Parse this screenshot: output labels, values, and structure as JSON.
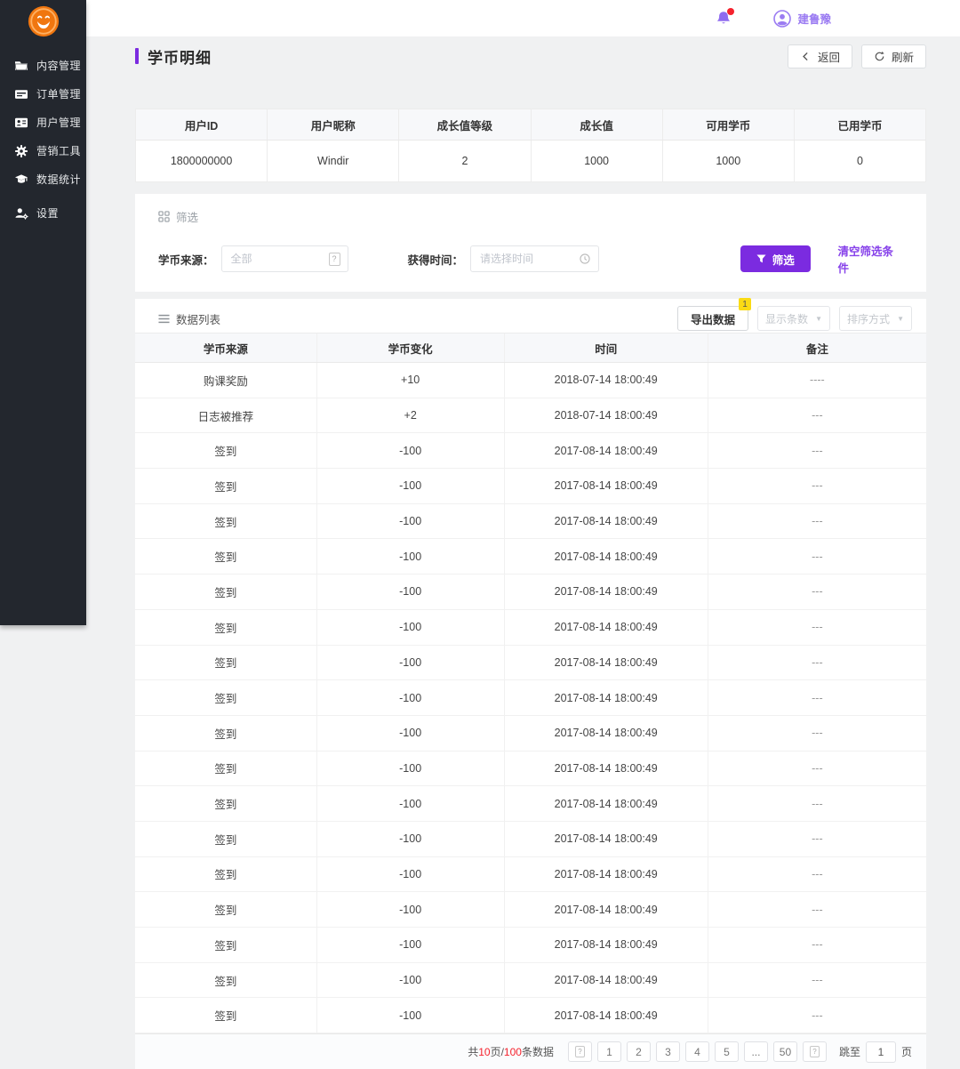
{
  "colors": {
    "accent": "#7b2be0",
    "accent_link": "#8742ea",
    "accent_soft": "#9b7cf2",
    "sidebar_bg": "#23272e",
    "content_bg": "#f0f1f2",
    "header_row_bg": "#f7f8fa",
    "red": "#f5222d",
    "badge_yellow": "#fadb14",
    "border": "#e8e8e8"
  },
  "sidebar": {
    "items": [
      {
        "id": "content",
        "icon": "folder-icon",
        "label": "内容管理"
      },
      {
        "id": "orders",
        "icon": "order-card-icon",
        "label": "订单管理"
      },
      {
        "id": "users",
        "icon": "contact-card-icon",
        "label": "用户管理"
      },
      {
        "id": "marketing",
        "icon": "gear-icon",
        "label": "营销工具"
      },
      {
        "id": "stats",
        "icon": "graduation-cap-icon",
        "label": "数据统计"
      },
      {
        "id": "settings",
        "icon": "person-gear-icon",
        "label": "设置"
      }
    ]
  },
  "header": {
    "username": "建鲁豫"
  },
  "page": {
    "title": "学币明细",
    "back_label": "返回",
    "refresh_label": "刷新"
  },
  "user_table": {
    "headers": [
      "用户ID",
      "用户昵称",
      "成长值等级",
      "成长值",
      "可用学币",
      "已用学币"
    ],
    "row": [
      "1800000000",
      "Windir",
      "2",
      "1000",
      "1000",
      "0"
    ]
  },
  "filter": {
    "section_title": "筛选",
    "source_label": "学币来源：",
    "source_placeholder": "全部",
    "time_label": "获得时间：",
    "time_placeholder": "请选择时间",
    "filter_button": "筛选",
    "clear_link": "清空筛选条件"
  },
  "datalist": {
    "section_title": "数据列表",
    "export_button": "导出数据",
    "export_badge": "1",
    "show_count_label": "显示条数",
    "sort_label": "排序方式",
    "columns": [
      "学币来源",
      "学币变化",
      "时间",
      "备注"
    ],
    "rows": [
      [
        "购课奖励",
        "+10",
        "2018-07-14 18:00:49",
        "----"
      ],
      [
        "日志被推荐",
        "+2",
        "2018-07-14 18:00:49",
        "---"
      ],
      [
        "签到",
        "-100",
        "2017-08-14 18:00:49",
        "---"
      ],
      [
        "签到",
        "-100",
        "2017-08-14 18:00:49",
        "---"
      ],
      [
        "签到",
        "-100",
        "2017-08-14 18:00:49",
        "---"
      ],
      [
        "签到",
        "-100",
        "2017-08-14 18:00:49",
        "---"
      ],
      [
        "签到",
        "-100",
        "2017-08-14 18:00:49",
        "---"
      ],
      [
        "签到",
        "-100",
        "2017-08-14 18:00:49",
        "---"
      ],
      [
        "签到",
        "-100",
        "2017-08-14 18:00:49",
        "---"
      ],
      [
        "签到",
        "-100",
        "2017-08-14 18:00:49",
        "---"
      ],
      [
        "签到",
        "-100",
        "2017-08-14 18:00:49",
        "---"
      ],
      [
        "签到",
        "-100",
        "2017-08-14 18:00:49",
        "---"
      ],
      [
        "签到",
        "-100",
        "2017-08-14 18:00:49",
        "---"
      ],
      [
        "签到",
        "-100",
        "2017-08-14 18:00:49",
        "---"
      ],
      [
        "签到",
        "-100",
        "2017-08-14 18:00:49",
        "---"
      ],
      [
        "签到",
        "-100",
        "2017-08-14 18:00:49",
        "---"
      ],
      [
        "签到",
        "-100",
        "2017-08-14 18:00:49",
        "---"
      ],
      [
        "签到",
        "-100",
        "2017-08-14 18:00:49",
        "---"
      ],
      [
        "签到",
        "-100",
        "2017-08-14 18:00:49",
        "---"
      ]
    ]
  },
  "pagination": {
    "summary_prefix": "共",
    "total_pages": "10",
    "pages_suffix": "页/",
    "total_items": "100",
    "items_suffix": "条数据",
    "pages": [
      "1",
      "2",
      "3",
      "4",
      "5",
      "...",
      "50"
    ],
    "jump_label": "跳至",
    "jump_value": "1",
    "jump_suffix": "页"
  }
}
